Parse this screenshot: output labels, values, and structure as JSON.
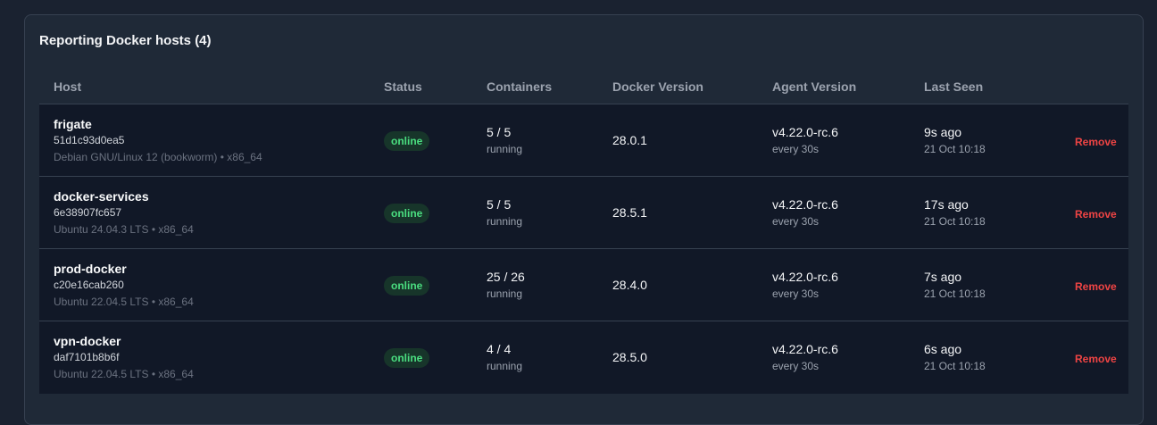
{
  "panel": {
    "title": "Reporting Docker hosts (4)"
  },
  "columns": {
    "host": "Host",
    "status": "Status",
    "containers": "Containers",
    "docker_version": "Docker Version",
    "agent_version": "Agent Version",
    "last_seen": "Last Seen"
  },
  "colors": {
    "online_badge_bg": "#17352a",
    "online_badge_text": "#4ade80",
    "remove": "#ef4444"
  },
  "rows": [
    {
      "name": "frigate",
      "id": "51d1c93d0ea5",
      "os": "Debian GNU/Linux 12 (bookworm) • x86_64",
      "status": "online",
      "containers": "5 / 5",
      "containers_sub": "running",
      "docker_version": "28.0.1",
      "agent_version": "v4.22.0-rc.6",
      "agent_interval": "every 30s",
      "last_seen": "9s ago",
      "last_seen_date": "21 Oct 10:18",
      "action": "Remove"
    },
    {
      "name": "docker-services",
      "id": "6e38907fc657",
      "os": "Ubuntu 24.04.3 LTS • x86_64",
      "status": "online",
      "containers": "5 / 5",
      "containers_sub": "running",
      "docker_version": "28.5.1",
      "agent_version": "v4.22.0-rc.6",
      "agent_interval": "every 30s",
      "last_seen": "17s ago",
      "last_seen_date": "21 Oct 10:18",
      "action": "Remove"
    },
    {
      "name": "prod-docker",
      "id": "c20e16cab260",
      "os": "Ubuntu 22.04.5 LTS • x86_64",
      "status": "online",
      "containers": "25 / 26",
      "containers_sub": "running",
      "docker_version": "28.4.0",
      "agent_version": "v4.22.0-rc.6",
      "agent_interval": "every 30s",
      "last_seen": "7s ago",
      "last_seen_date": "21 Oct 10:18",
      "action": "Remove"
    },
    {
      "name": "vpn-docker",
      "id": "daf7101b8b6f",
      "os": "Ubuntu 22.04.5 LTS • x86_64",
      "status": "online",
      "containers": "4 / 4",
      "containers_sub": "running",
      "docker_version": "28.5.0",
      "agent_version": "v4.22.0-rc.6",
      "agent_interval": "every 30s",
      "last_seen": "6s ago",
      "last_seen_date": "21 Oct 10:18",
      "action": "Remove"
    }
  ]
}
